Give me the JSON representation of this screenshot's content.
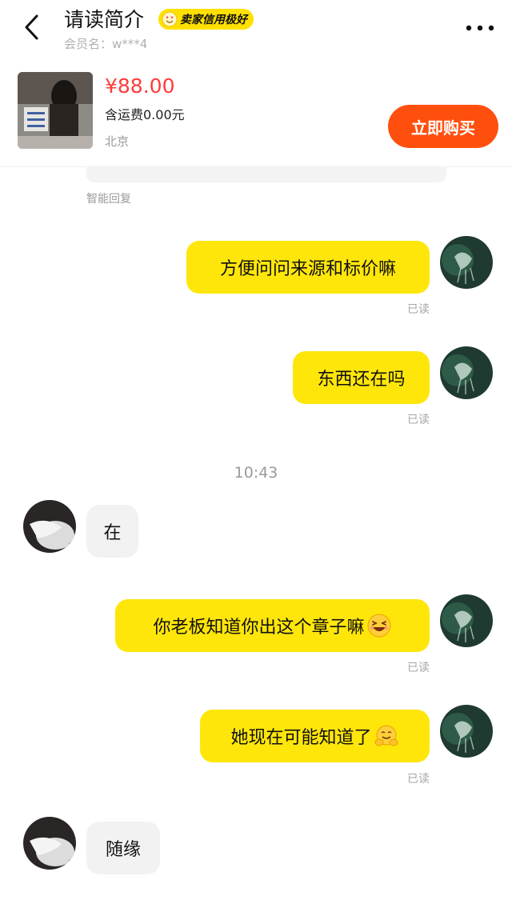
{
  "header": {
    "title": "请读简介",
    "badge_label": "卖家信用极好",
    "member_label": "会员名：w***4"
  },
  "product": {
    "price": "¥88.00",
    "shipping": "含运费0.00元",
    "location": "北京",
    "buy_label": "立即购买"
  },
  "chat": {
    "smart_reply_label": "智能回复",
    "timestamp": "10:43",
    "messages": [
      {
        "from": "me",
        "text": "方便问问来源和标价嘛",
        "status": "已读"
      },
      {
        "from": "me",
        "text": "东西还在吗",
        "status": "已读"
      },
      {
        "from": "seller",
        "text": "在"
      },
      {
        "from": "me",
        "text": "你老板知道你出这个章子嘛",
        "emoji": "grinning-squint-emoji",
        "status": "已读"
      },
      {
        "from": "me",
        "text": "她现在可能知道了",
        "emoji": "hugging-face-emoji",
        "status": "已读"
      },
      {
        "from": "seller",
        "text": "随缘"
      }
    ]
  },
  "colors": {
    "accent_yellow": "#ffe60a",
    "buy_orange": "#ff4f0e",
    "price_red": "#ff3b3b"
  }
}
